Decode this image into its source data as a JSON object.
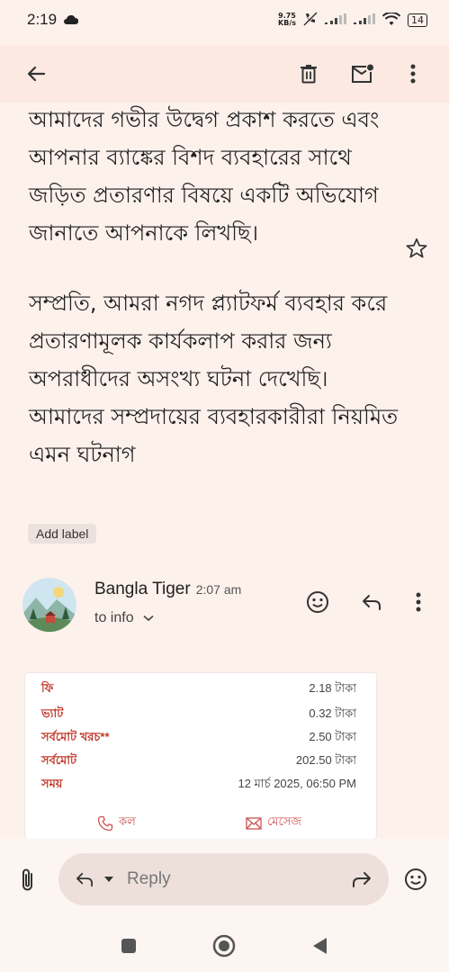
{
  "status": {
    "time": "2:19",
    "net_speed_value": "9.75",
    "net_speed_unit": "KB/s",
    "battery": "14"
  },
  "toolbar": {
    "back": "back-arrow-icon",
    "delete": "trash-icon",
    "mark_unread": "mark-unread-icon",
    "more": "more-vert-icon"
  },
  "email": {
    "paragraphs": [
      "আমাদের গভীর উদ্বেগ প্রকাশ করতে এবং আপনার ব্যাঙ্কের বিশদ ব্যবহারের সাথে জড়িত প্রতারণার বিষয়ে একটি অভিযোগ জানাতে আপনাকে লিখছি।",
      "সম্প্রতি, আমরা নগদ প্ল্যাটফর্ম ব্যবহার করে প্রতারণামূলক কার্যকলাপ করার জন্য অপরাধীদের অসংখ্য ঘটনা দেখেছি। আমাদের সম্প্রদায়ের ব্যবহারকারীরা নিয়মিত এমন ঘটনাগ"
    ],
    "add_label": "Add label"
  },
  "message": {
    "sender": "Bangla Tiger",
    "time": "2:07 am",
    "to": "to info"
  },
  "receipt": {
    "rows": [
      {
        "label": "ফি",
        "value": "2.18 টাকা"
      },
      {
        "label": "ভ্যাট",
        "value": "0.32 টাকা"
      },
      {
        "label": "সর্বমোট খরচ**",
        "value": "2.50 টাকা"
      },
      {
        "label": "সর্বমোট",
        "value": "202.50 টাকা"
      },
      {
        "label": "সময়",
        "value": "12 মার্চ 2025, 06:50 PM"
      }
    ],
    "call_label": "কল",
    "message_label": "মেসেজ"
  },
  "reply": {
    "placeholder": "Reply"
  },
  "colors": {
    "accent": "#c0392b",
    "background": "#fdf1ec"
  }
}
